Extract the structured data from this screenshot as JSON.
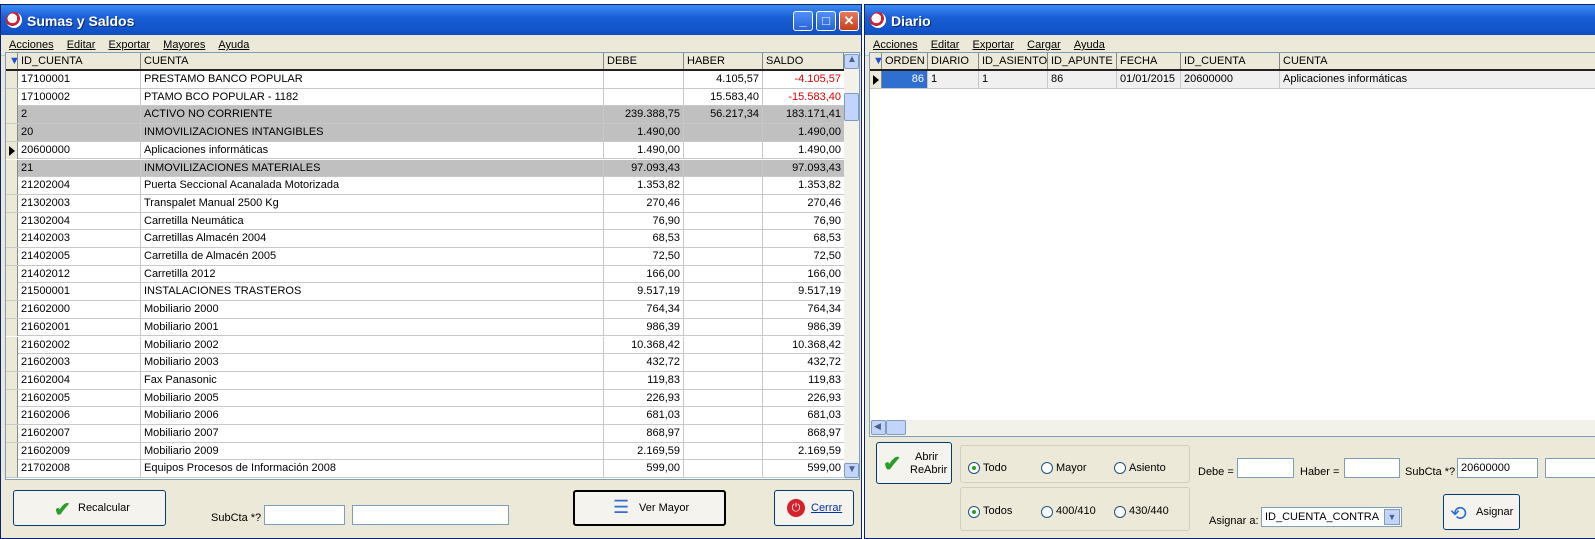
{
  "top_strip": "",
  "left_window": {
    "title": "Sumas y Saldos",
    "menu": [
      "Acciones",
      "Editar",
      "Exportar",
      "Mayores",
      "Ayuda"
    ],
    "columns": [
      "ID_CUENTA",
      "CUENTA",
      "DEBE",
      "HABER",
      "SALDO"
    ],
    "rows": [
      {
        "id": "17100001",
        "cuenta": "PRESTAMO BANCO POPULAR",
        "debe": "",
        "haber": "4.105,57",
        "saldo": "-4.105,57",
        "neg": true,
        "grp": false,
        "cur": false
      },
      {
        "id": "17100002",
        "cuenta": "PTAMO BCO POPULAR - 1182",
        "debe": "",
        "haber": "15.583,40",
        "saldo": "-15.583,40",
        "neg": true,
        "grp": false,
        "cur": false
      },
      {
        "id": "2",
        "cuenta": "ACTIVO NO CORRIENTE",
        "debe": "239.388,75",
        "haber": "56.217,34",
        "saldo": "183.171,41",
        "neg": false,
        "grp": true,
        "cur": false
      },
      {
        "id": "20",
        "cuenta": "INMOVILIZACIONES INTANGIBLES",
        "debe": "1.490,00",
        "haber": "",
        "saldo": "1.490,00",
        "neg": false,
        "grp": true,
        "cur": false
      },
      {
        "id": "20600000",
        "cuenta": "Aplicaciones informáticas",
        "debe": "1.490,00",
        "haber": "",
        "saldo": "1.490,00",
        "neg": false,
        "grp": false,
        "cur": true
      },
      {
        "id": "21",
        "cuenta": "INMOVILIZACIONES MATERIALES",
        "debe": "97.093,43",
        "haber": "",
        "saldo": "97.093,43",
        "neg": false,
        "grp": true,
        "cur": false
      },
      {
        "id": "21202004",
        "cuenta": "Puerta Seccional Acanalada Motorizada",
        "debe": "1.353,82",
        "haber": "",
        "saldo": "1.353,82",
        "neg": false,
        "grp": false,
        "cur": false
      },
      {
        "id": "21302003",
        "cuenta": "Transpalet Manual 2500 Kg",
        "debe": "270,46",
        "haber": "",
        "saldo": "270,46",
        "neg": false,
        "grp": false,
        "cur": false
      },
      {
        "id": "21302004",
        "cuenta": "Carretilla Neumática",
        "debe": "76,90",
        "haber": "",
        "saldo": "76,90",
        "neg": false,
        "grp": false,
        "cur": false
      },
      {
        "id": "21402003",
        "cuenta": "Carretillas Almacén 2004",
        "debe": "68,53",
        "haber": "",
        "saldo": "68,53",
        "neg": false,
        "grp": false,
        "cur": false
      },
      {
        "id": "21402005",
        "cuenta": "Carretilla de Almacén 2005",
        "debe": "72,50",
        "haber": "",
        "saldo": "72,50",
        "neg": false,
        "grp": false,
        "cur": false
      },
      {
        "id": "21402012",
        "cuenta": "Carretilla 2012",
        "debe": "166,00",
        "haber": "",
        "saldo": "166,00",
        "neg": false,
        "grp": false,
        "cur": false
      },
      {
        "id": "21500001",
        "cuenta": "INSTALACIONES TRASTEROS",
        "debe": "9.517,19",
        "haber": "",
        "saldo": "9.517,19",
        "neg": false,
        "grp": false,
        "cur": false
      },
      {
        "id": "21602000",
        "cuenta": "Mobiliario 2000",
        "debe": "764,34",
        "haber": "",
        "saldo": "764,34",
        "neg": false,
        "grp": false,
        "cur": false
      },
      {
        "id": "21602001",
        "cuenta": "Mobiliario 2001",
        "debe": "986,39",
        "haber": "",
        "saldo": "986,39",
        "neg": false,
        "grp": false,
        "cur": false
      },
      {
        "id": "21602002",
        "cuenta": "Mobiliario 2002",
        "debe": "10.368,42",
        "haber": "",
        "saldo": "10.368,42",
        "neg": false,
        "grp": false,
        "cur": false
      },
      {
        "id": "21602003",
        "cuenta": "Mobiliario 2003",
        "debe": "432,72",
        "haber": "",
        "saldo": "432,72",
        "neg": false,
        "grp": false,
        "cur": false
      },
      {
        "id": "21602004",
        "cuenta": "Fax Panasonic",
        "debe": "119,83",
        "haber": "",
        "saldo": "119,83",
        "neg": false,
        "grp": false,
        "cur": false
      },
      {
        "id": "21602005",
        "cuenta": "Mobiliario 2005",
        "debe": "226,93",
        "haber": "",
        "saldo": "226,93",
        "neg": false,
        "grp": false,
        "cur": false
      },
      {
        "id": "21602006",
        "cuenta": "Mobiliario 2006",
        "debe": "681,03",
        "haber": "",
        "saldo": "681,03",
        "neg": false,
        "grp": false,
        "cur": false
      },
      {
        "id": "21602007",
        "cuenta": "Mobiliario 2007",
        "debe": "868,97",
        "haber": "",
        "saldo": "868,97",
        "neg": false,
        "grp": false,
        "cur": false
      },
      {
        "id": "21602009",
        "cuenta": "Mobiliario 2009",
        "debe": "2.169,59",
        "haber": "",
        "saldo": "2.169,59",
        "neg": false,
        "grp": false,
        "cur": false
      },
      {
        "id": "21702008",
        "cuenta": "Equipos Procesos de Información 2008",
        "debe": "599,00",
        "haber": "",
        "saldo": "599,00",
        "neg": false,
        "grp": false,
        "cur": false
      }
    ],
    "recalcular": "Recalcular",
    "subcta_label": "SubCta *?",
    "subcta_value": "",
    "subcta_value2": "",
    "ver_mayor": "Ver Mayor",
    "cerrar": "Cerrar"
  },
  "right_window": {
    "title": "Diario",
    "menu": [
      "Acciones",
      "Editar",
      "Exportar",
      "Cargar",
      "Ayuda"
    ],
    "columns": [
      "ORDEN",
      "DIARIO",
      "ID_ASIENTO",
      "ID_APUNTE",
      "FECHA",
      "ID_CUENTA",
      "CUENTA"
    ],
    "row": {
      "orden": "86",
      "diario": "1",
      "id_asiento": "1",
      "id_apunte": "86",
      "fecha": "01/01/2015",
      "id_cuenta": "20600000",
      "cuenta": "Aplicaciones informáticas"
    },
    "abrir": "Abrir",
    "reabrir": "ReAbrir",
    "radio1": [
      "Todo",
      "Mayor",
      "Asiento"
    ],
    "radio2": [
      "Todos",
      "400/410",
      "430/440"
    ],
    "debe_label": "Debe =",
    "haber_label": "Haber =",
    "subcta_label": "SubCta *?",
    "subcta_value": "20600000",
    "asignar_label": "Asignar a:",
    "asignar_value": "ID_CUENTA_CONTRA",
    "asignar_btn": "Asignar"
  }
}
